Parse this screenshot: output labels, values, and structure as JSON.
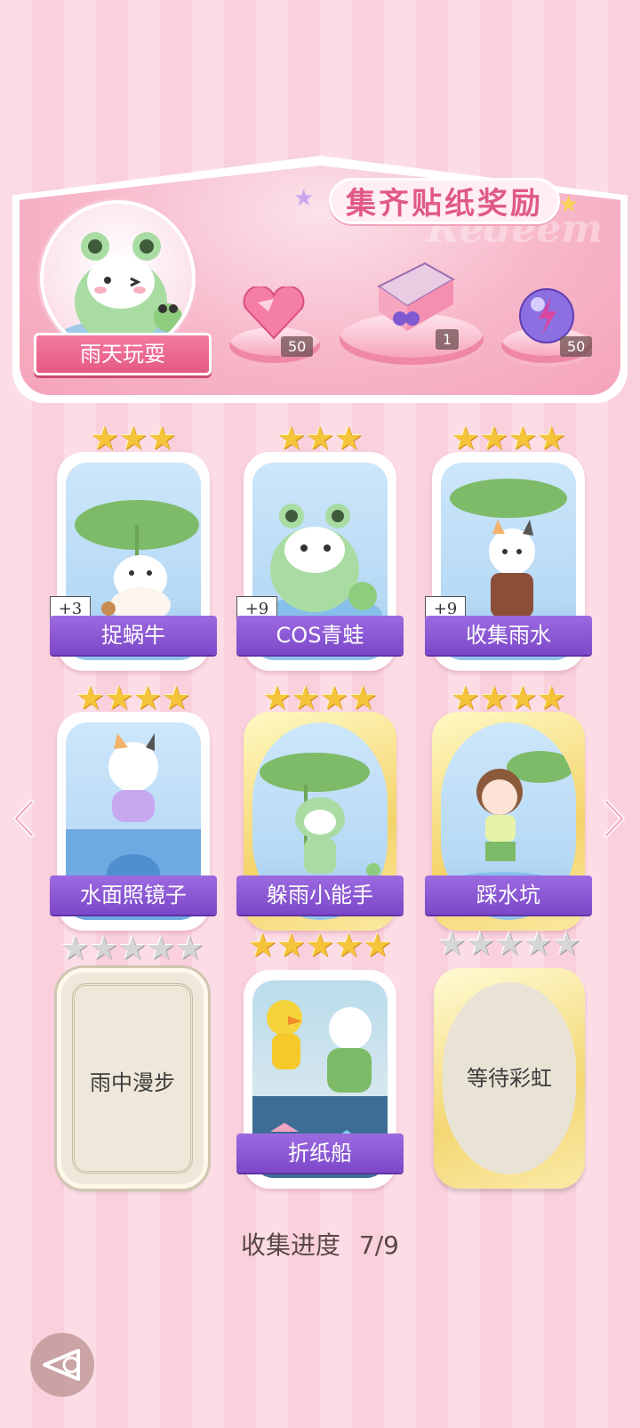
{
  "banner": {
    "title": "集齐贴纸奖励",
    "watermark": "Redeem",
    "theme_label": "雨天玩耍",
    "rewards": [
      {
        "icon": "heart-gem-icon",
        "count": "50"
      },
      {
        "icon": "gift-box-icon",
        "count": "1"
      },
      {
        "icon": "energy-orb-icon",
        "count": "50"
      }
    ]
  },
  "stickers": [
    {
      "name": "捉蜗牛",
      "stars": 3,
      "plus": "+3",
      "frame": "white",
      "collected": true
    },
    {
      "name": "COS青蛙",
      "stars": 3,
      "plus": "+9",
      "frame": "white",
      "collected": true
    },
    {
      "name": "收集雨水",
      "stars": 4,
      "plus": "+9",
      "frame": "white",
      "collected": true
    },
    {
      "name": "水面照镜子",
      "stars": 4,
      "frame": "white",
      "collected": true
    },
    {
      "name": "躲雨小能手",
      "stars": 4,
      "frame": "gold",
      "collected": true
    },
    {
      "name": "踩水坑",
      "stars": 4,
      "frame": "gold",
      "collected": true
    },
    {
      "name": "雨中漫步",
      "stars": 5,
      "frame": "white",
      "collected": false
    },
    {
      "name": "折纸船",
      "stars": 5,
      "frame": "white",
      "collected": true
    },
    {
      "name": "等待彩虹",
      "stars": 5,
      "frame": "gold",
      "collected": false
    }
  ],
  "progress": {
    "label": "收集进度",
    "value": "7/9"
  },
  "colors": {
    "accent": "#7c48c9",
    "pink": "#e55a85",
    "gold": "#f4d36a"
  }
}
